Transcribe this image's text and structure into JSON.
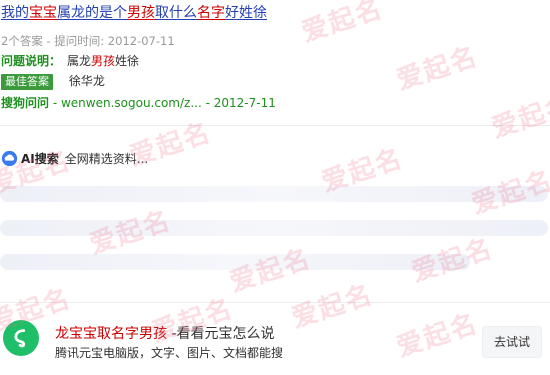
{
  "result": {
    "title_parts": [
      "我的",
      "宝宝",
      "属龙的是个",
      "男孩",
      "取什么",
      "名字",
      "好姓徐"
    ],
    "meta": "2个答案 - 提问时间: 2012-07-11",
    "question_label": "问题说明：",
    "question_parts": [
      "属龙",
      "男孩",
      "姓徐"
    ],
    "best_answer_badge": "最佳答案",
    "best_answer_text": "徐华龙",
    "source_name": "搜狗问问",
    "source_rest": " - wenwen.sogou.com/z... - 2012-7-11"
  },
  "ai": {
    "label": "AI搜索",
    "text": "全网精选资料..."
  },
  "promo": {
    "title_highlight": "龙宝宝取名字男孩",
    "title_rest": " -看看元宝怎么说",
    "subtitle": "腾讯元宝电脑版，文字、图片、文档都能搜",
    "button_label": "去试试"
  },
  "watermark": "爱起名",
  "colors": {
    "link_blue": "#2440b3",
    "highlight_red": "#cc0000",
    "source_green": "#1c8f1c",
    "badge_green": "#3c9a3c",
    "logo_green": "#1fbf6a"
  }
}
